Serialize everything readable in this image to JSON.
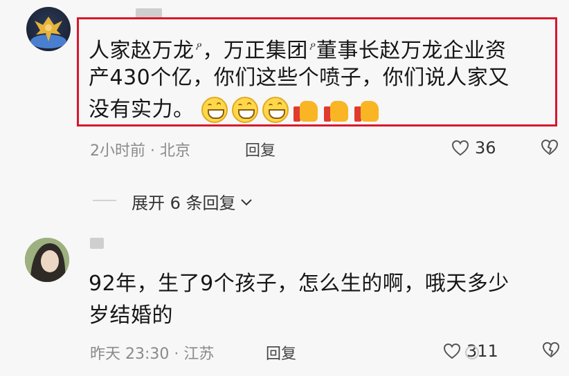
{
  "comments": [
    {
      "text_line1_a": "人家赵万龙",
      "text_line1_b": "，万正",
      "text_line1_c": "集团",
      "text_line1_d": "董事长赵万龙企业资",
      "text_line2": "产430个亿，你们这些个喷子，你们说人家又",
      "text_line3": "没有实力。",
      "search_mark": "ዖ",
      "emojis": [
        "smile",
        "smile",
        "smile",
        "thumbs-up",
        "thumbs-up",
        "thumbs-up"
      ],
      "time": "2小时前",
      "location": "· 北京",
      "reply_label": "回复",
      "likes": "36",
      "expand_label": "展开 6 条回复",
      "expand_arrow": "⌄"
    },
    {
      "text_line1": "92年，生了9个孩子，怎么生的啊，哦天多少",
      "text_line2": "岁结婚的",
      "time": "昨天 23:30",
      "location": "· 江苏",
      "reply_label": "回复",
      "likes": "311"
    }
  ],
  "colors": {
    "highlight_border": "#d9162b",
    "background": "#f7f7f7",
    "meta_text": "#8a8a8a"
  }
}
